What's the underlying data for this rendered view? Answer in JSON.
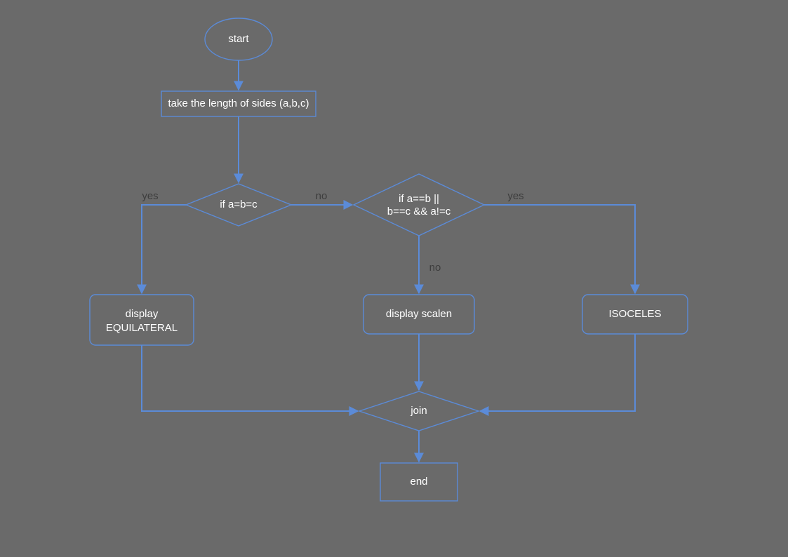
{
  "nodes": {
    "start": {
      "label": "start"
    },
    "input": {
      "label": "take the length of sides (a,b,c)"
    },
    "dec1": {
      "label": "if a=b=c"
    },
    "dec2": {
      "line1": "if a==b ||",
      "line2": "b==c && a!=c"
    },
    "outEqui": {
      "line1": "display",
      "line2": "EQUILATERAL"
    },
    "outScal": {
      "label": "display scalen"
    },
    "outIso": {
      "label": "ISOCELES"
    },
    "join": {
      "label": "join"
    },
    "end": {
      "label": "end"
    }
  },
  "edges": {
    "dec1_yes": "yes",
    "dec1_no": "no",
    "dec2_yes": "yes",
    "dec2_no": "no"
  },
  "style": {
    "stroke": "#5b8bd8",
    "bg": "#6a6a6a"
  }
}
